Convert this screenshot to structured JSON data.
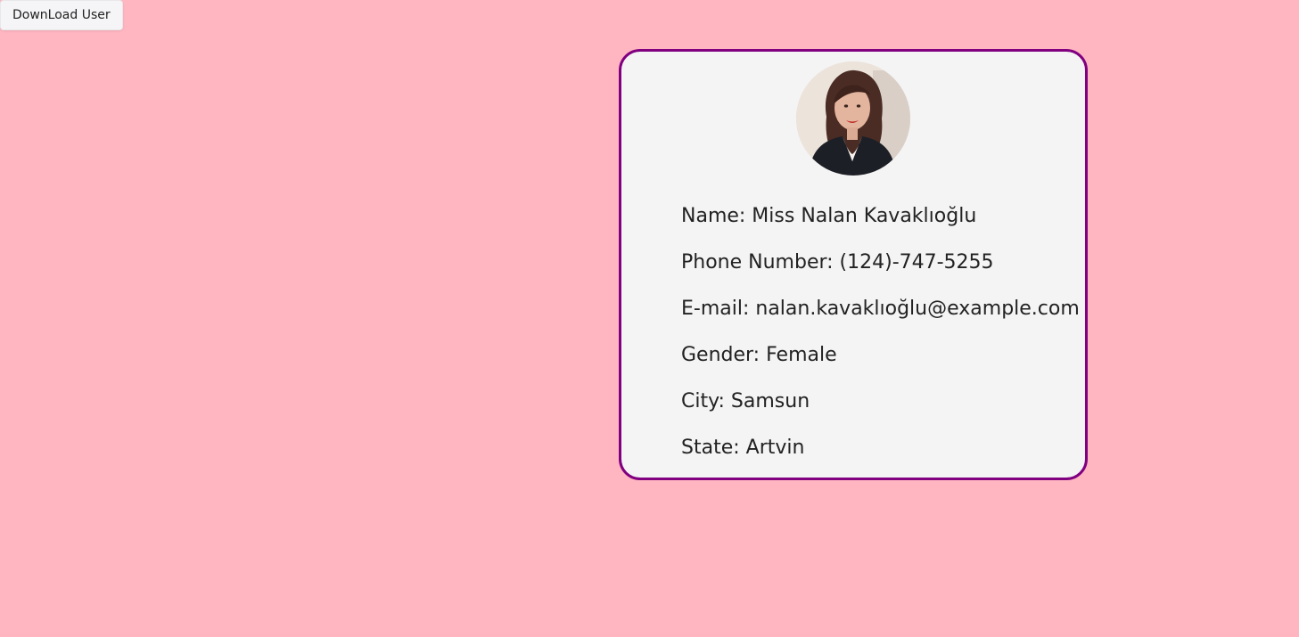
{
  "toolbar": {
    "download_label": "DownLoad User"
  },
  "user": {
    "avatar_icon": "user-photo",
    "fields": [
      {
        "label": "Name",
        "value": "Miss Nalan Kavaklıoğlu"
      },
      {
        "label": "Phone Number",
        "value": "(124)-747-5255"
      },
      {
        "label": "E-mail",
        "value": "nalan.kavaklıoğlu@example.com"
      },
      {
        "label": "Gender",
        "value": "Female"
      },
      {
        "label": "City",
        "value": "Samsun"
      },
      {
        "label": "State",
        "value": "Artvin"
      }
    ],
    "lines": {
      "name": "Name: Miss Nalan Kavaklıoğlu",
      "phone": "Phone Number: (124)-747-5255",
      "email": "E-mail: nalan.kavaklıoğlu@example.com",
      "gender": "Gender: Female",
      "city": "City: Samsun",
      "state": "State: Artvin"
    }
  },
  "colors": {
    "page_background": "#ffb6c1",
    "card_border": "#800080",
    "card_background": "#f4f4f5"
  }
}
